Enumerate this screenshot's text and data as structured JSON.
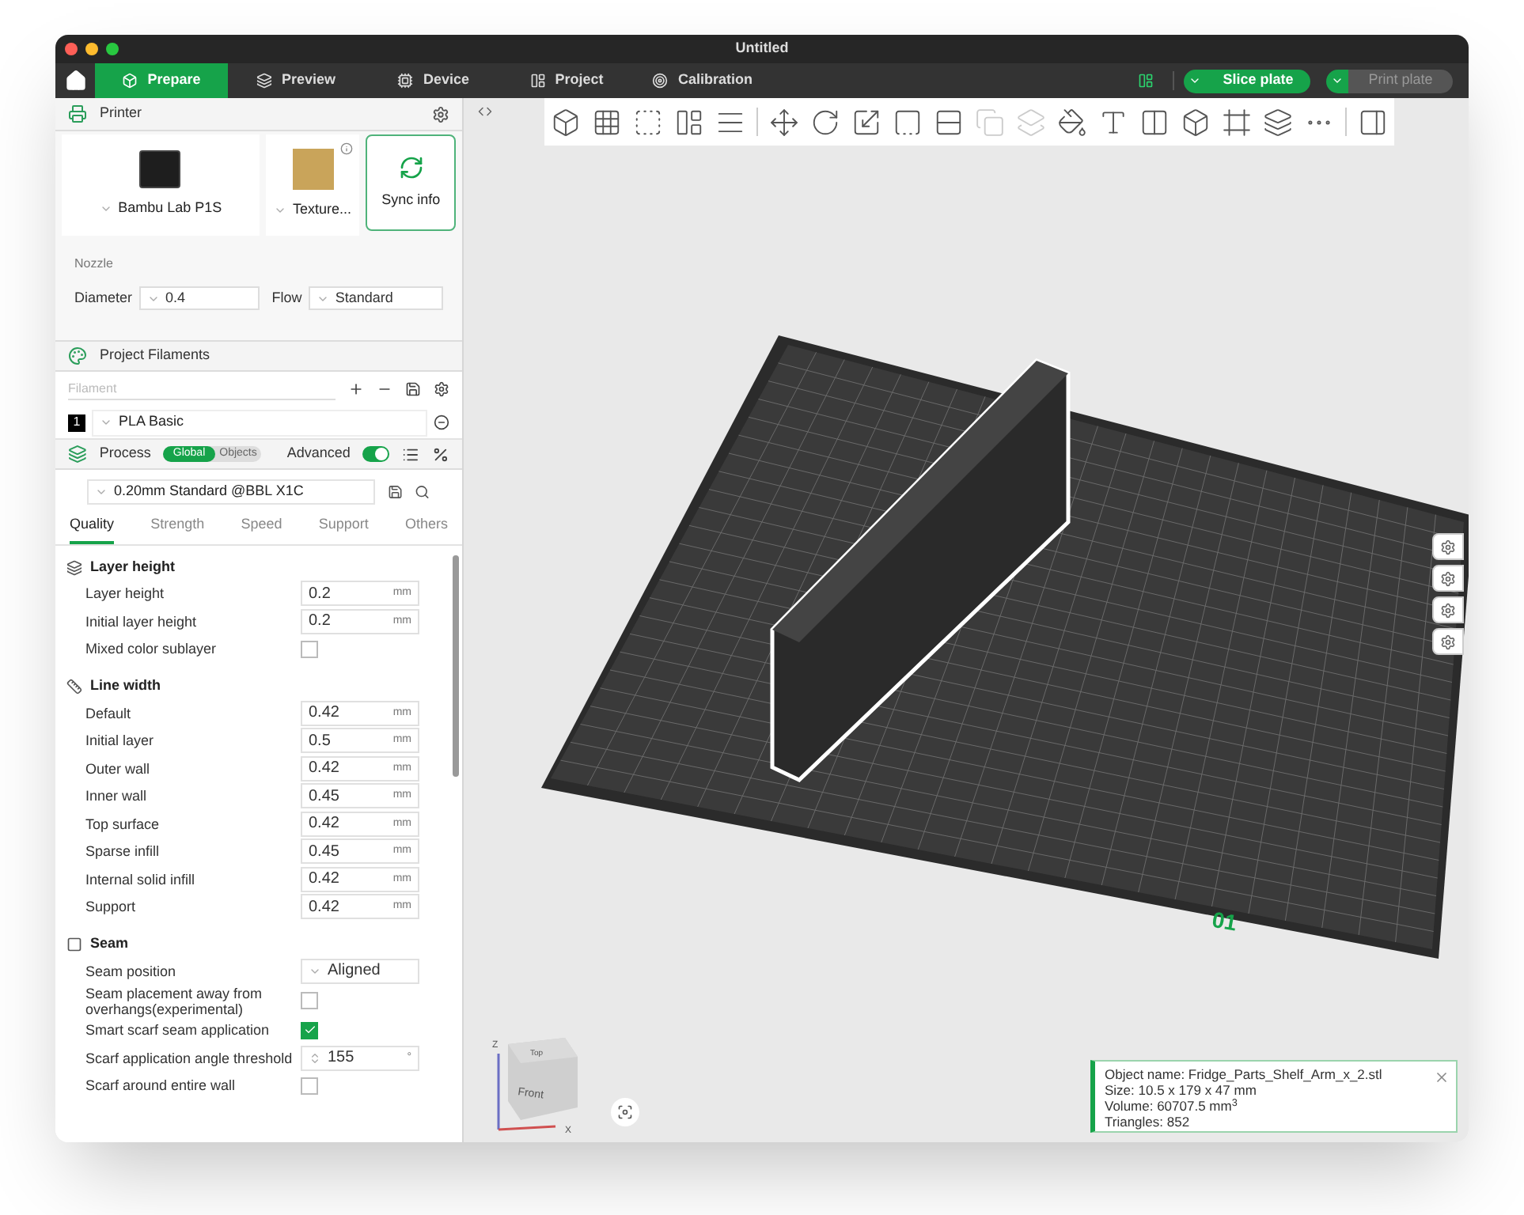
{
  "window": {
    "title": "Untitled"
  },
  "tabs": [
    {
      "label": "Prepare",
      "selected": true
    },
    {
      "label": "Preview",
      "selected": false
    },
    {
      "label": "Device",
      "selected": false
    },
    {
      "label": "Project",
      "selected": false
    },
    {
      "label": "Calibration",
      "selected": false
    }
  ],
  "actions": [
    {
      "label": "Slice plate",
      "disabled": false
    },
    {
      "label": "Print plate",
      "disabled": true
    }
  ],
  "printer": {
    "title": "Printer",
    "model": "Bambu Lab P1S",
    "plate": "Texture...",
    "sync": "Sync info",
    "nozzle_heading": "Nozzle",
    "diameter_label": "Diameter",
    "diameter": "0.4",
    "flow_label": "Flow",
    "flow": "Standard"
  },
  "filaments": {
    "title": "Project Filaments",
    "placeholder": "Filament",
    "items": [
      {
        "index": "1",
        "name": "PLA Basic"
      }
    ]
  },
  "process": {
    "title": "Process",
    "scopes": [
      {
        "label": "Global",
        "selected": true
      },
      {
        "label": "Objects",
        "selected": false
      }
    ],
    "advanced_label": "Advanced",
    "advanced_on": true,
    "preset": "0.20mm Standard @BBL X1C",
    "tabs": [
      {
        "label": "Quality",
        "selected": true
      },
      {
        "label": "Strength",
        "selected": false
      },
      {
        "label": "Speed",
        "selected": false
      },
      {
        "label": "Support",
        "selected": false
      },
      {
        "label": "Others",
        "selected": false
      }
    ],
    "sections": [
      {
        "title": "Layer height",
        "rows": [
          {
            "kind": "number",
            "label": "Layer height",
            "value": "0.2",
            "unit": "mm"
          },
          {
            "kind": "number",
            "label": "Initial layer height",
            "value": "0.2",
            "unit": "mm"
          },
          {
            "kind": "checkbox",
            "label": "Mixed color sublayer",
            "checked": false
          }
        ]
      },
      {
        "title": "Line width",
        "rows": [
          {
            "kind": "number",
            "label": "Default",
            "value": "0.42",
            "unit": "mm"
          },
          {
            "kind": "number",
            "label": "Initial layer",
            "value": "0.5",
            "unit": "mm"
          },
          {
            "kind": "number",
            "label": "Outer wall",
            "value": "0.42",
            "unit": "mm"
          },
          {
            "kind": "number",
            "label": "Inner wall",
            "value": "0.45",
            "unit": "mm"
          },
          {
            "kind": "number",
            "label": "Top surface",
            "value": "0.42",
            "unit": "mm"
          },
          {
            "kind": "number",
            "label": "Sparse infill",
            "value": "0.45",
            "unit": "mm"
          },
          {
            "kind": "number",
            "label": "Internal solid infill",
            "value": "0.42",
            "unit": "mm"
          },
          {
            "kind": "number",
            "label": "Support",
            "value": "0.42",
            "unit": "mm"
          }
        ]
      },
      {
        "title": "Seam",
        "rows": [
          {
            "kind": "select",
            "label": "Seam position",
            "value": "Aligned"
          },
          {
            "kind": "checkbox",
            "label": "Seam placement away from overhangs(experimental)",
            "checked": false
          },
          {
            "kind": "checkbox",
            "label": "Smart scarf seam application",
            "checked": true
          },
          {
            "kind": "spin",
            "label": "Scarf application angle threshold",
            "value": "155",
            "unit": "°"
          },
          {
            "kind": "checkbox",
            "label": "Scarf around entire wall",
            "checked": false
          }
        ]
      }
    ]
  },
  "viewport": {
    "plate_number": "01",
    "view_cube": {
      "top": "Top",
      "front": "Front",
      "z_axis": "Z",
      "x_axis": "X"
    },
    "object_info": [
      "Object name: Fridge_Parts_Shelf_Arm_x_2.stl",
      "Size: 10.5 x 179 x 47 mm",
      "Volume: 60707.5 mm$^{3}$",
      "Triangles: 852"
    ]
  }
}
